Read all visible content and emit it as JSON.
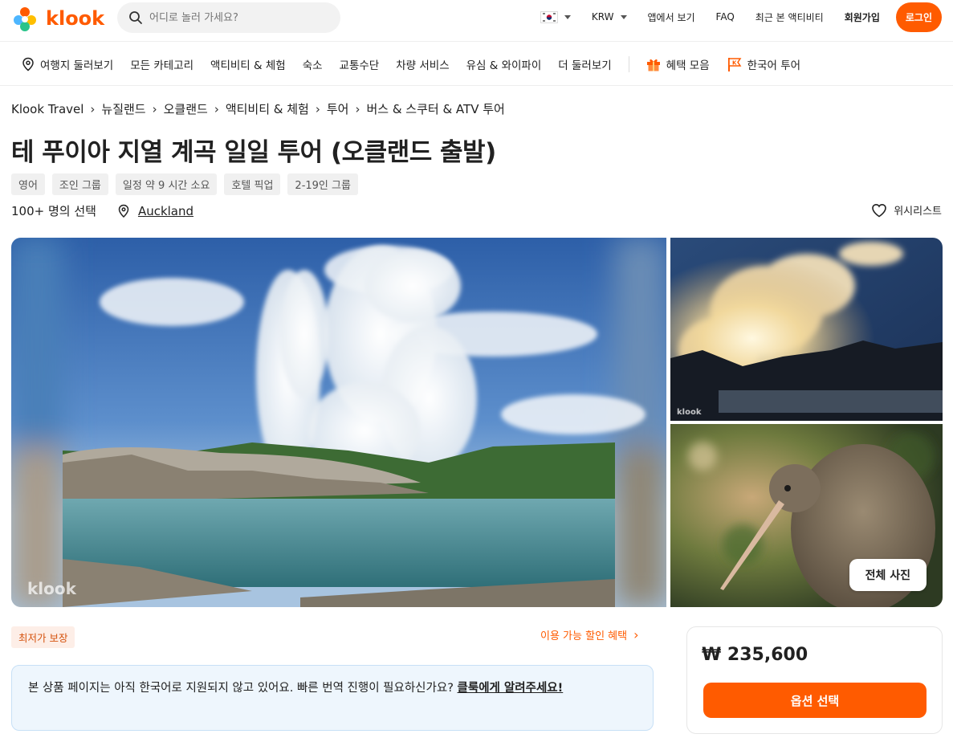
{
  "header": {
    "logo_text": "klook",
    "search_placeholder": "어디로 놀러 가세요?",
    "currency": "KRW",
    "app_link": "앱에서 보기",
    "faq": "FAQ",
    "recent": "최근 본 액티비티",
    "signup": "회원가입",
    "login": "로그인"
  },
  "catnav": {
    "items": [
      "여행지 둘러보기",
      "모든 카테고리",
      "액티비티 & 체험",
      "숙소",
      "교통수단",
      "차량 서비스",
      "유심 & 와이파이",
      "더 둘러보기"
    ],
    "benefits": "혜택 모음",
    "korean_tour": "한국어 투어"
  },
  "breadcrumb": [
    "Klook Travel",
    "뉴질랜드",
    "오클랜드",
    "액티비티 & 체험",
    "투어",
    "버스 & 스쿠터 & ATV 투어"
  ],
  "title": "테 푸이아 지열 계곡 일일 투어 (오클랜드 출발)",
  "tags": [
    "영어",
    "조인 그룹",
    "일정 약 9 시간  소요",
    "호텔 픽업",
    "2-19인 그룹"
  ],
  "meta": {
    "booked": "100+ 명의 선택",
    "location": "Auckland",
    "wishlist": "위시리스트"
  },
  "gallery": {
    "watermark": "klook",
    "all_photos": "전체 사진"
  },
  "bottom": {
    "badge": "최저가 보장",
    "discount": "이용 가능 할인 혜택",
    "notice_text": "본 상품 페이지는 아직 한국어로 지원되지 않고 있어요. 빠른 번역 진행이 필요하신가요? ",
    "notice_link": "클룩에게 알려주세요!",
    "price": "₩ 235,600",
    "select_option": "옵션 선택"
  },
  "colors": {
    "brand": "#ff5b00",
    "notice_bg": "#eef6fd"
  }
}
